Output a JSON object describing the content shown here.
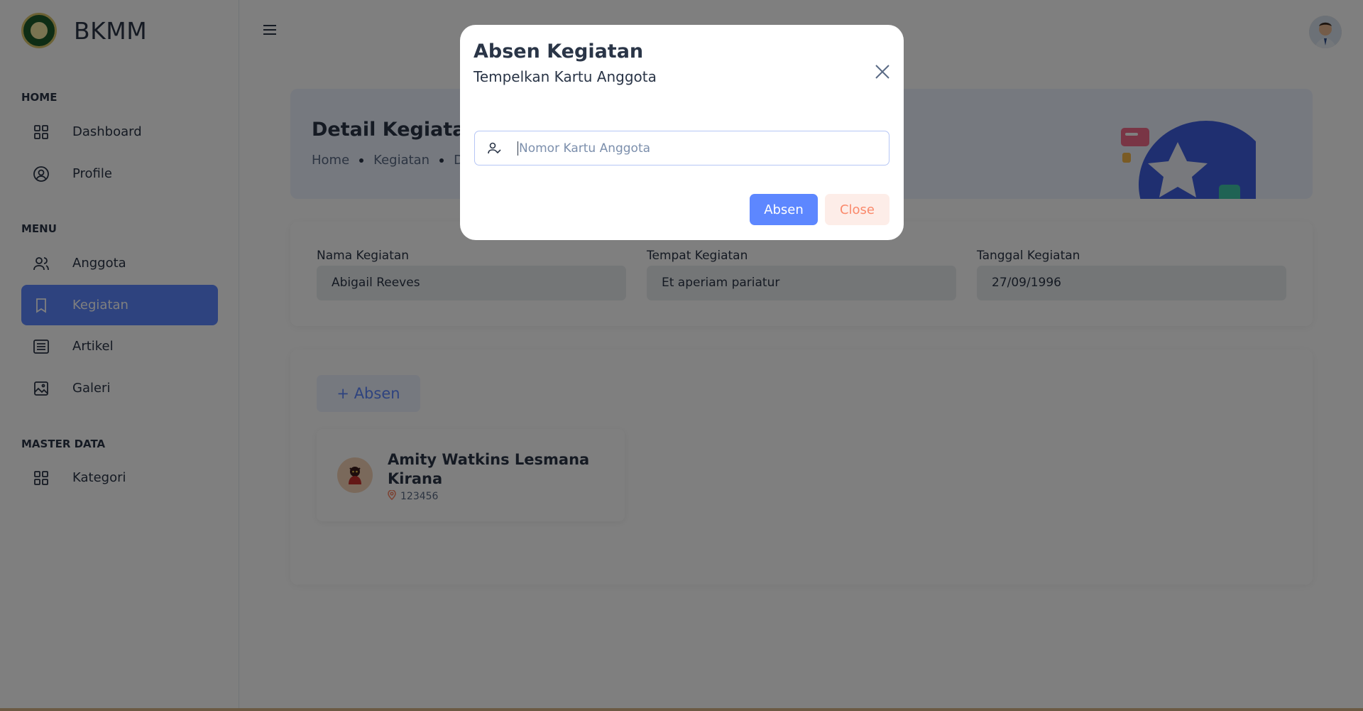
{
  "brand": {
    "name": "BKMM",
    "logo": "bkmm-logo"
  },
  "sidebar": {
    "sections": [
      {
        "title": "HOME",
        "items": [
          {
            "label": "Dashboard",
            "icon": "grid-icon"
          },
          {
            "label": "Profile",
            "icon": "user-circle-icon"
          }
        ]
      },
      {
        "title": "MENU",
        "items": [
          {
            "label": "Anggota",
            "icon": "users-icon"
          },
          {
            "label": "Kegiatan",
            "icon": "bookmark-icon",
            "active": true
          },
          {
            "label": "Artikel",
            "icon": "article-icon"
          },
          {
            "label": "Galeri",
            "icon": "photo-icon"
          }
        ]
      },
      {
        "title": "MASTER DATA",
        "items": [
          {
            "label": "Kategori",
            "icon": "grid-icon"
          }
        ]
      }
    ]
  },
  "header": {
    "menu_icon": "menu-icon",
    "avatar": "user-avatar"
  },
  "banner": {
    "title": "Detail Kegiatan",
    "breadcrumbs": [
      "Home",
      "Kegiatan",
      "De"
    ]
  },
  "detail": {
    "fields": [
      {
        "label": "Nama Kegiatan",
        "value": "Abigail Reeves"
      },
      {
        "label": "Tempat Kegiatan",
        "value": "Et aperiam pariatur"
      },
      {
        "label": "Tanggal Kegiatan",
        "value": "27/09/1996"
      }
    ]
  },
  "attendance": {
    "add_label": "+ Absen",
    "members": [
      {
        "name": "Amity Watkins Lesmana Kirana",
        "id": "123456"
      }
    ]
  },
  "modal": {
    "title": "Absen Kegiatan",
    "subtitle": "Tempelkan Kartu Anggota",
    "input_placeholder": "Nomor Kartu Anggota",
    "input_icon": "user-check-icon",
    "submit_label": "Absen",
    "close_label": "Close"
  },
  "colors": {
    "primary": "#5d87ff",
    "light_primary": "#ecf2ff",
    "danger": "#fa896b",
    "light_danger": "#fdede8",
    "text": "#2a3547"
  }
}
